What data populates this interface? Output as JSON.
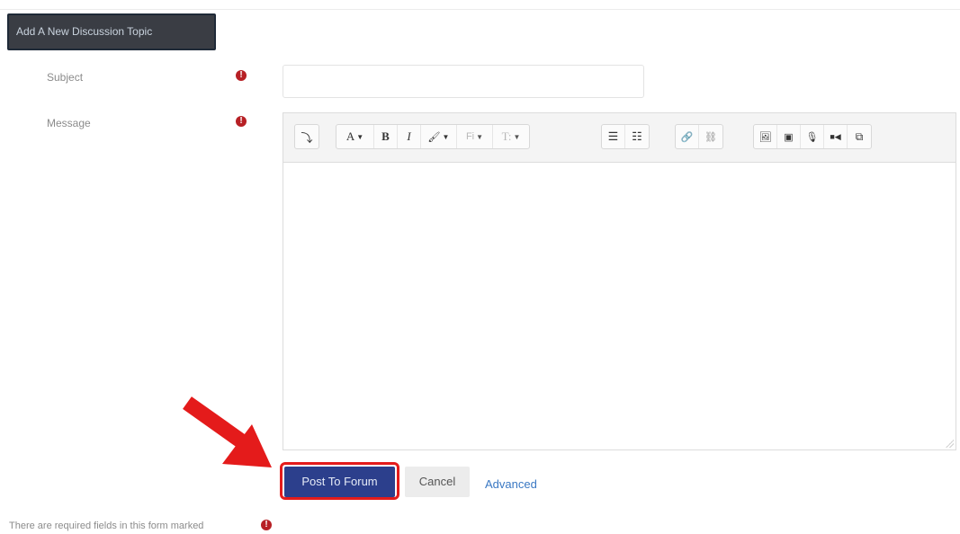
{
  "header": {
    "add_topic_label": "Add A New Discussion Topic"
  },
  "form": {
    "subject": {
      "label": "Subject",
      "value": "",
      "placeholder": ""
    },
    "message": {
      "label": "Message"
    },
    "required_icon": "exclamation-circle-icon"
  },
  "toolbar": {
    "groups": [
      [
        {
          "name": "collapse",
          "glyph": "⤵"
        }
      ],
      [
        {
          "name": "font-family",
          "glyph": "A",
          "caret": true
        },
        {
          "name": "bold",
          "glyph": "B"
        },
        {
          "name": "italic",
          "glyph": "I"
        },
        {
          "name": "brush",
          "glyph": "🖌",
          "caret": true
        },
        {
          "name": "font-size",
          "glyph": "Fi",
          "caret": true
        },
        {
          "name": "paragraph",
          "glyph": "T:",
          "caret": true
        }
      ],
      [
        {
          "name": "unordered-list",
          "glyph": "☰"
        },
        {
          "name": "ordered-list",
          "glyph": "☷"
        }
      ],
      [
        {
          "name": "link",
          "glyph": "🔗"
        },
        {
          "name": "unlink",
          "glyph": "⛓"
        }
      ],
      [
        {
          "name": "image",
          "glyph": "🖼"
        },
        {
          "name": "file",
          "glyph": "▣"
        },
        {
          "name": "microphone",
          "glyph": "🎙"
        },
        {
          "name": "video",
          "glyph": "■◀"
        },
        {
          "name": "copy",
          "glyph": "⧉"
        }
      ]
    ]
  },
  "actions": {
    "post_label": "Post To Forum",
    "cancel_label": "Cancel",
    "advanced_label": "Advanced"
  },
  "footer": {
    "required_note": "There are required fields in this form marked"
  },
  "colors": {
    "primary": "#2c3f8c",
    "required": "#b72025",
    "highlight": "#e41b1b",
    "link": "#3a78c3",
    "header_bg": "#3a3d44"
  }
}
